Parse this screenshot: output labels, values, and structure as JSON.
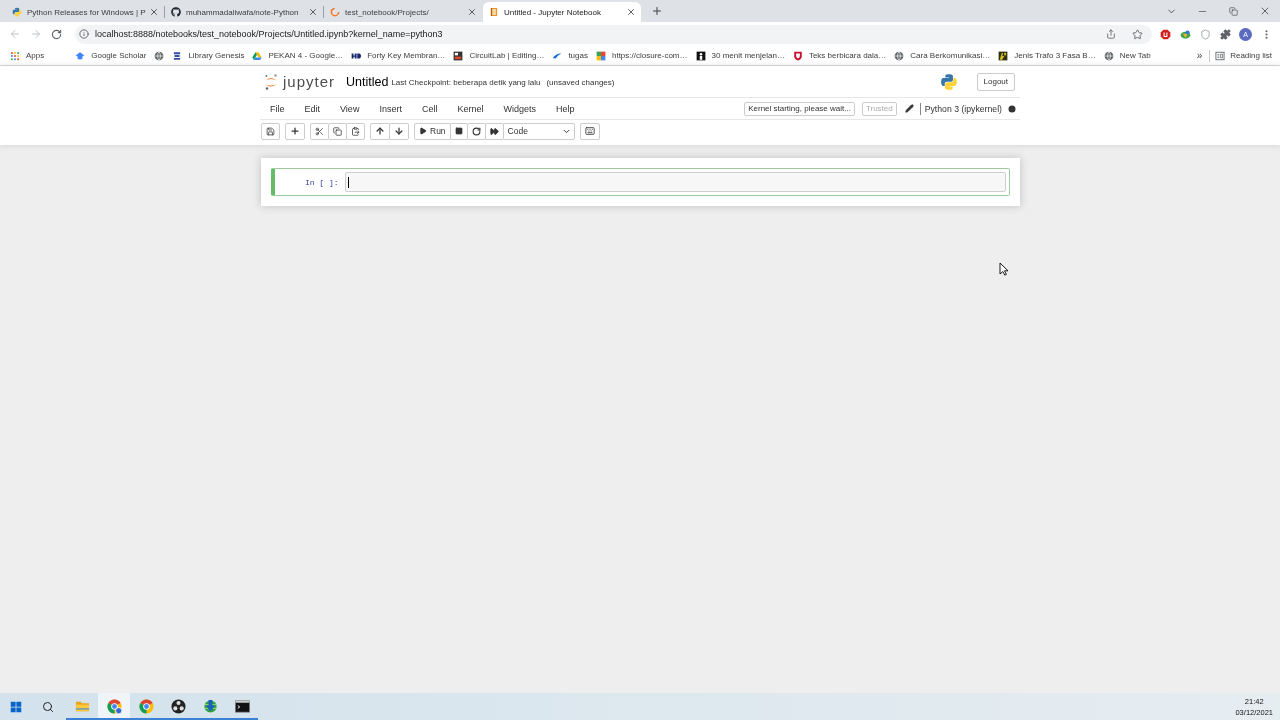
{
  "browser": {
    "tabs": [
      {
        "title": "Python Releases for Windows | P",
        "selected": false
      },
      {
        "title": "muhammadaliwafa/note-Python",
        "selected": false
      },
      {
        "title": "test_notebook/Projects/",
        "selected": false
      },
      {
        "title": "Untitled - Jupyter Notebook",
        "selected": true
      }
    ],
    "address_bar": {
      "back_disabled": true,
      "forward_disabled": true,
      "url": "localhost:8888/notebooks/test_notebook/Projects/Untitled.ipynb?kernel_name=python3"
    },
    "profile_initial": "A",
    "bookmarks": [
      {
        "kind": "apps",
        "label": "Apps"
      },
      {
        "kind": "link",
        "label": "Google Scholar"
      },
      {
        "kind": "icon_only"
      },
      {
        "kind": "link",
        "label": "Library Genesis"
      },
      {
        "kind": "link",
        "label": "PEKAN 4 - Google…"
      },
      {
        "kind": "link",
        "label": "Forty Key Membran…"
      },
      {
        "kind": "link",
        "label": "CircuitLab | Editing…"
      },
      {
        "kind": "link",
        "label": "tugas"
      },
      {
        "kind": "link",
        "label": "https://closure-com…"
      },
      {
        "kind": "link",
        "label": "30 menit menjelan…"
      },
      {
        "kind": "link",
        "label": "Teks berbicara dala…"
      },
      {
        "kind": "link",
        "label": "Cara Berkomunikasi…"
      },
      {
        "kind": "link",
        "label": "Jenis Trafo 3 Fasa B…"
      },
      {
        "kind": "link",
        "label": "New Tab"
      }
    ],
    "more_bookmarks": "»",
    "reading_list": "Reading list"
  },
  "notebook": {
    "logo_text": "jupyter",
    "title": "Untitled",
    "checkpoint": "Last Checkpoint: beberapa detik yang lalu",
    "autosave_status": "(unsaved changes)",
    "logout": "Logout",
    "menu": [
      "File",
      "Edit",
      "View",
      "Insert",
      "Cell",
      "Kernel",
      "Widgets",
      "Help"
    ],
    "kernel_status": "Kernel starting, please wait...",
    "trusted": {
      "label": "Trusted",
      "disabled": true
    },
    "kernel_name": "Python 3 (ipykernel)",
    "kernel_busy": true,
    "toolbar": {
      "run_label": "Run",
      "cell_type": "Code"
    },
    "cells": [
      {
        "prompt": "In [ ]:",
        "selected": true
      }
    ]
  },
  "taskbar": {
    "apps": [
      {
        "running": true,
        "selected": false
      },
      {
        "running": true,
        "selected": true
      },
      {
        "running": true,
        "selected": false
      },
      {
        "running": true,
        "selected": false
      },
      {
        "running": true,
        "selected": false
      },
      {
        "running": true,
        "selected": false
      }
    ],
    "time": "21:42",
    "date": "03/12/2021"
  }
}
